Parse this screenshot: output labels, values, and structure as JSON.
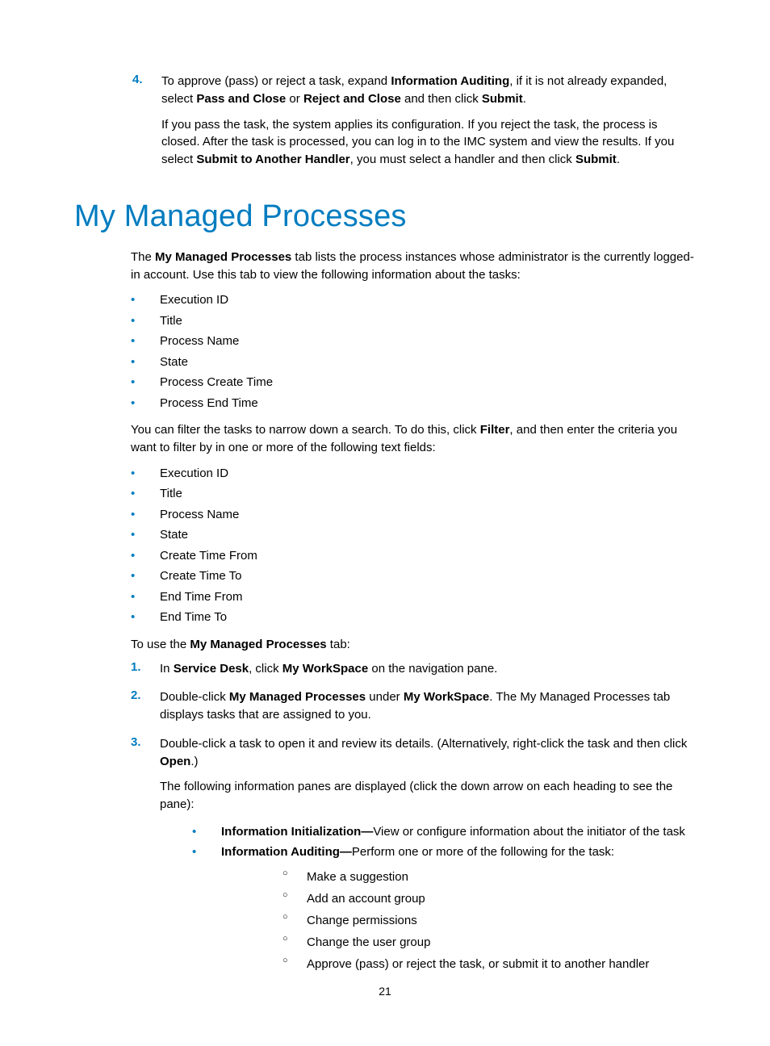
{
  "step4": {
    "num": "4.",
    "p1_a": "To approve (pass) or reject a task, expand ",
    "p1_b": "Information Auditing",
    "p1_c": ", if it is not already expanded, select ",
    "p1_d": "Pass and Close",
    "p1_e": " or ",
    "p1_f": "Reject and Close",
    "p1_g": " and then click ",
    "p1_h": "Submit",
    "p1_i": ".",
    "p2_a": "If you pass the task, the system applies its configuration. If you reject the task, the process is closed. After the task is processed, you can log in to the IMC system and view the results. If you select ",
    "p2_b": "Submit to Another Handler",
    "p2_c": ", you must select a handler and then click ",
    "p2_d": "Submit",
    "p2_e": "."
  },
  "heading": "My Managed Processes",
  "intro": {
    "a": "The ",
    "b": "My Managed Processes",
    "c": " tab lists the process instances whose administrator is the currently logged-in account. Use this tab to view the following information about the tasks:"
  },
  "viewFields": [
    "Execution ID",
    "Title",
    "Process Name",
    "State",
    "Process Create Time",
    "Process End Time"
  ],
  "filterIntro": {
    "a": "You can filter the tasks to narrow down a search. To do this, click ",
    "b": "Filter",
    "c": ", and then enter the criteria you want to filter by in one or more of the following text fields:"
  },
  "filterFields": [
    "Execution ID",
    "Title",
    "Process Name",
    "State",
    "Create Time From",
    "Create Time To",
    "End Time From",
    "End Time To"
  ],
  "useIntro": {
    "a": "To use the ",
    "b": "My Managed Processes",
    "c": " tab:"
  },
  "steps": {
    "s1": {
      "num": "1.",
      "a": "In ",
      "b": "Service Desk",
      "c": ", click ",
      "d": "My WorkSpace",
      "e": " on the navigation pane."
    },
    "s2": {
      "num": "2.",
      "a": "Double-click ",
      "b": "My Managed Processes",
      "c": " under ",
      "d": "My WorkSpace",
      "e": ". The My Managed Processes tab displays tasks that are assigned to you."
    },
    "s3": {
      "num": "3.",
      "a": "Double-click a task to open it and review its details. (Alternatively, right-click the task and then click ",
      "b": "Open",
      "c": ".)",
      "d": "The following information panes are displayed (click the down arrow on each heading to see the pane):"
    }
  },
  "panes": {
    "p1": {
      "a": "Information Initialization—",
      "b": "View or configure information about the initiator of the task"
    },
    "p2": {
      "a": "Information Auditing—",
      "b": "Perform one or more of the following for the task:"
    }
  },
  "auditActions": [
    "Make a suggestion",
    "Add an account group",
    "Change permissions",
    "Change the user group",
    "Approve (pass) or reject the task, or submit it to another handler"
  ],
  "pageNumber": "21"
}
